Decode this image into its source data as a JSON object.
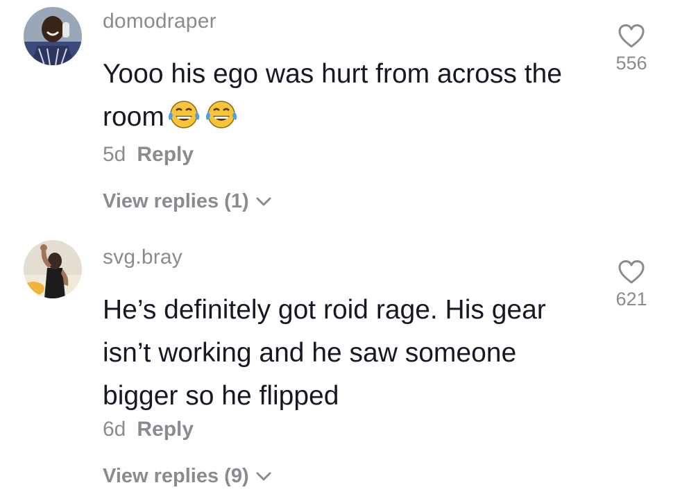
{
  "comments": [
    {
      "username": "domodraper",
      "text": "Yooo his ego was hurt from across the room",
      "emojis": [
        "face-with-tears-of-joy",
        "face-with-tears-of-joy"
      ],
      "time": "5d",
      "reply_label": "Reply",
      "view_replies": "View replies (1)",
      "likes": "556"
    },
    {
      "username": "svg.bray",
      "text": "He’s definitely got roid rage. His gear isn’t working and he saw someone bigger so he flipped",
      "time": "6d",
      "reply_label": "Reply",
      "view_replies": "View replies (9)",
      "likes": "621"
    }
  ],
  "colors": {
    "primary_text": "#161823",
    "secondary_text": "#8a8b91",
    "background": "#ffffff"
  },
  "icons": [
    "heart-outline-icon",
    "chevron-down-icon",
    "face-with-tears-of-joy"
  ]
}
